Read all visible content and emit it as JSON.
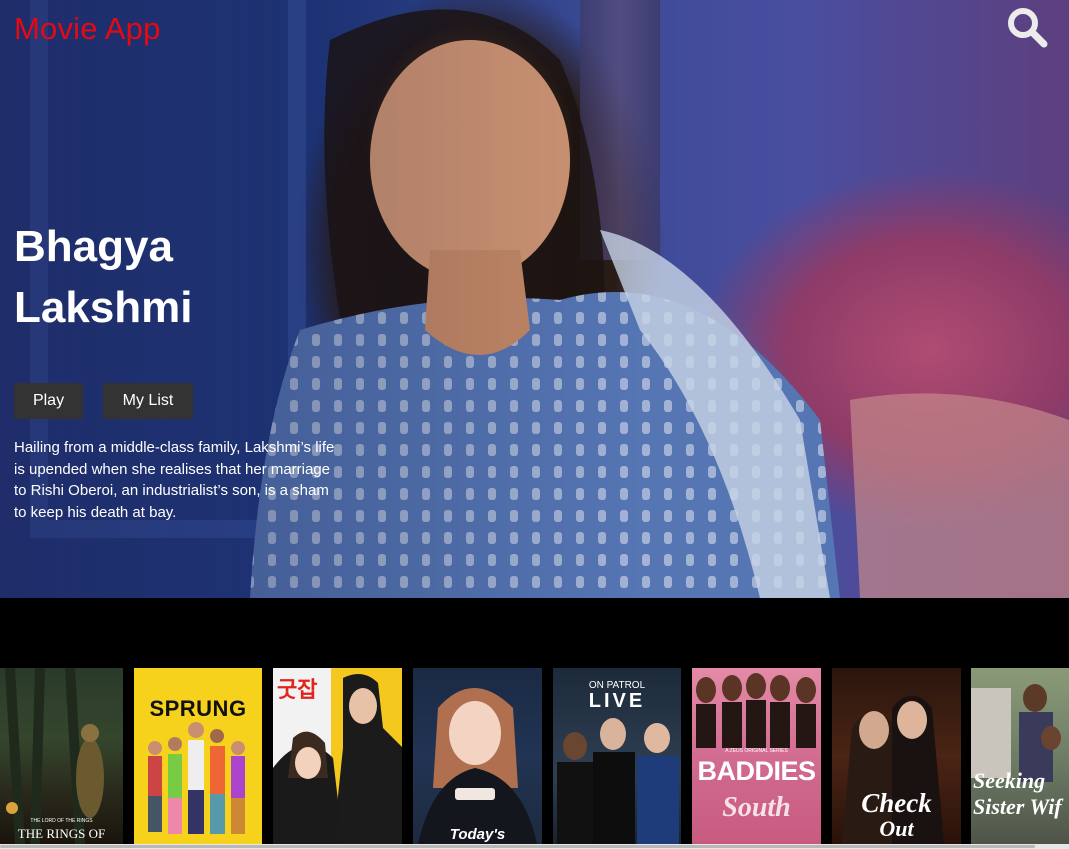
{
  "app": {
    "title": "Movie App"
  },
  "hero": {
    "title": "Bhagya Lakshmi",
    "play_label": "Play",
    "mylist_label": "My List",
    "description": "Hailing from a middle-class family, Lakshmi’s life is upended when she realises that her marriage to Rishi Oberoi, an industrialist’s son, is a sham to keep his death at bay."
  },
  "posters": [
    {
      "caption": "THE RINGS OF POWER",
      "kicker": "THE LORD OF THE RINGS"
    },
    {
      "caption": "SPRUNG"
    },
    {
      "caption": "굿잡"
    },
    {
      "caption": "Today's"
    },
    {
      "caption": "LIVE",
      "kicker": "ON PATROL"
    },
    {
      "caption": "BADDIES",
      "kicker": "South",
      "tag": "A ZEUS ORIGINAL SERIES"
    },
    {
      "caption": "Check",
      "kicker": "Out"
    },
    {
      "caption": "Seeking",
      "kicker": "Sister Wif"
    }
  ],
  "colors": {
    "brand": "#e50914",
    "button_bg": "#333333"
  }
}
